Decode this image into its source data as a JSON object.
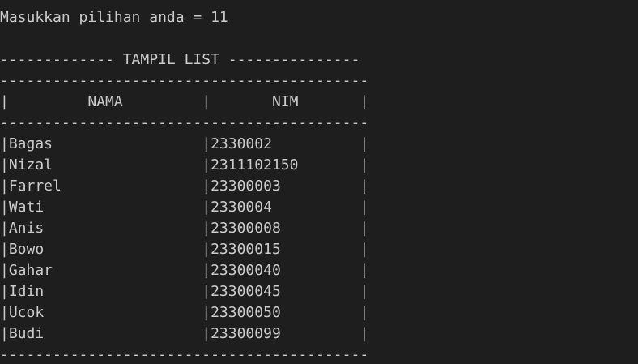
{
  "terminal": {
    "prompt_line": "Masukkan pilihan anda = 11",
    "title_line": "------------- TAMPIL LIST ---------------",
    "separator_top": "------------------------------------------",
    "header_line": "|         NAMA         |       NIM       |",
    "separator_header": "------------------------------------------",
    "rows": [
      "|Bagas                 |2330002          |",
      "|Nizal                 |2311102150       |",
      "|Farrel                |23300003         |",
      "|Wati                  |2330004          |",
      "|Anis                  |23300008         |",
      "|Bowo                  |23300015         |",
      "|Gahar                 |23300040         |",
      "|Idin                  |23300045         |",
      "|Ucok                  |23300050         |",
      "|Budi                  |23300099         |"
    ],
    "separator_bottom": "------------------------------------------"
  },
  "colors": {
    "background": "#1e1e1e",
    "text": "#cccccc"
  }
}
